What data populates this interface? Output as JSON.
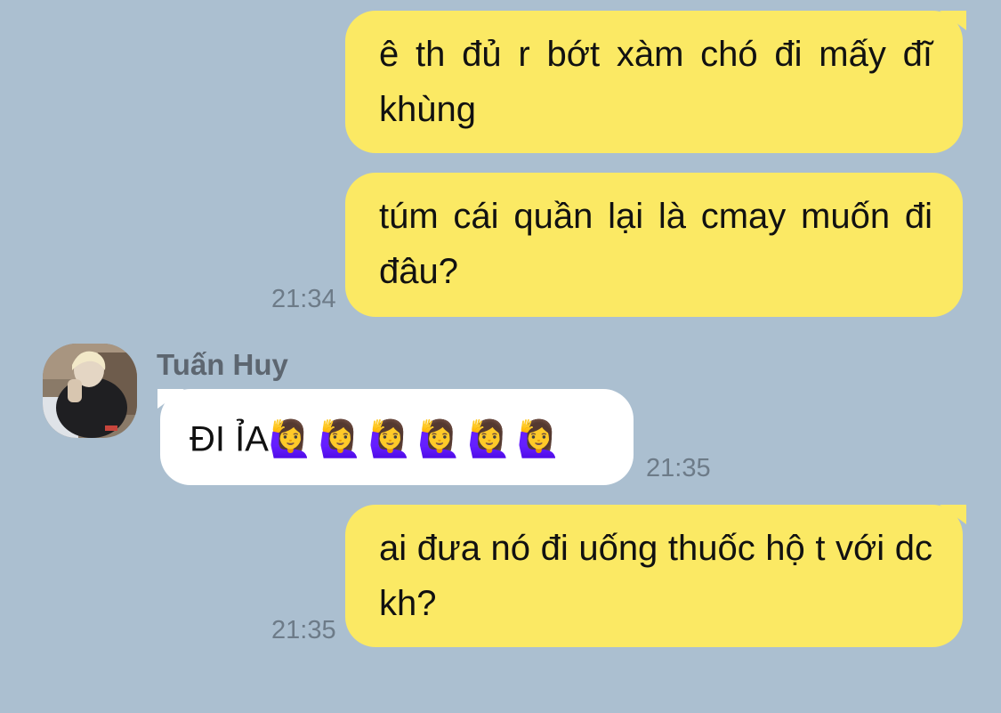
{
  "theme": {
    "background": "#abbfd0",
    "outgoing_bubble": "#fbe964",
    "incoming_bubble": "#ffffff",
    "timestamp_color": "#6d7b88",
    "sender_name_color": "#5d6670"
  },
  "messages": [
    {
      "direction": "outgoing",
      "text": "ê th đủ r bớt xàm chó đi mấy đĩ khùng",
      "time": ""
    },
    {
      "direction": "outgoing",
      "text": "túm cái quần lại là cmay muốn đi đâu?",
      "time": "21:34"
    },
    {
      "direction": "incoming",
      "sender": "Tuấn Huy",
      "avatar_icon": "user-avatar-photo",
      "text": "ĐI ỈA",
      "emoji": "🙋‍♀️🙋‍♀️🙋‍♀️🙋‍♀️🙋‍♀️🙋‍♀️",
      "time": "21:35"
    },
    {
      "direction": "outgoing",
      "text": "ai đưa nó đi uống thuốc hộ t với dc kh?",
      "time": "21:35"
    }
  ]
}
